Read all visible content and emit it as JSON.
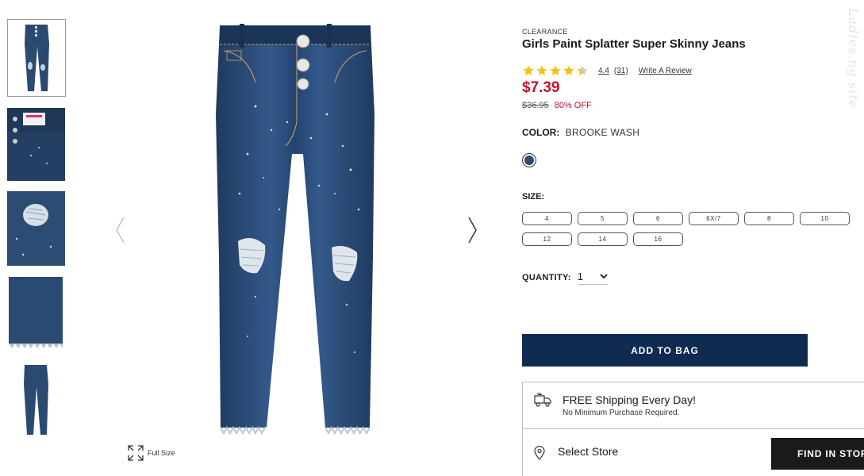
{
  "gallery": {
    "thumbnails": [
      "front-view",
      "waistband-detail",
      "knee-distress-detail",
      "raw-hem-detail",
      "full-front-view"
    ],
    "full_size_label": "Full Size",
    "prev_icon": "chevron-left-icon",
    "next_icon": "chevron-right-icon"
  },
  "product": {
    "badge": "CLEARANCE",
    "title": "Girls Paint Splatter Super Skinny Jeans",
    "rating": "4.4",
    "rating_count": "(31)",
    "rating_fraction": 0.88,
    "write_review": "Write A Review",
    "price": "$7.39",
    "old_price": "$36.95",
    "discount": "80% OFF",
    "color_label": "COLOR:",
    "color_value": "BROOKE WASH",
    "swatch_color": "#2e4c6d",
    "size_label": "SIZE:",
    "sizes": [
      "4",
      "5",
      "6",
      "6X/7",
      "8",
      "10",
      "12",
      "14",
      "16"
    ],
    "quantity_label": "QUANTITY:",
    "quantity_value": "1",
    "add_to_bag": "ADD TO BAG",
    "shipping_title": "FREE Shipping Every Day!",
    "shipping_sub": "No Minimum Purchase Required.",
    "select_store": "Select Store",
    "find_in_store": "FIND IN STORE"
  },
  "watermark": "Ladies.ng.site",
  "colors": {
    "brand_navy": "#0f2b52",
    "price_red": "#c8102e",
    "star_gold": "#f1c40f"
  }
}
